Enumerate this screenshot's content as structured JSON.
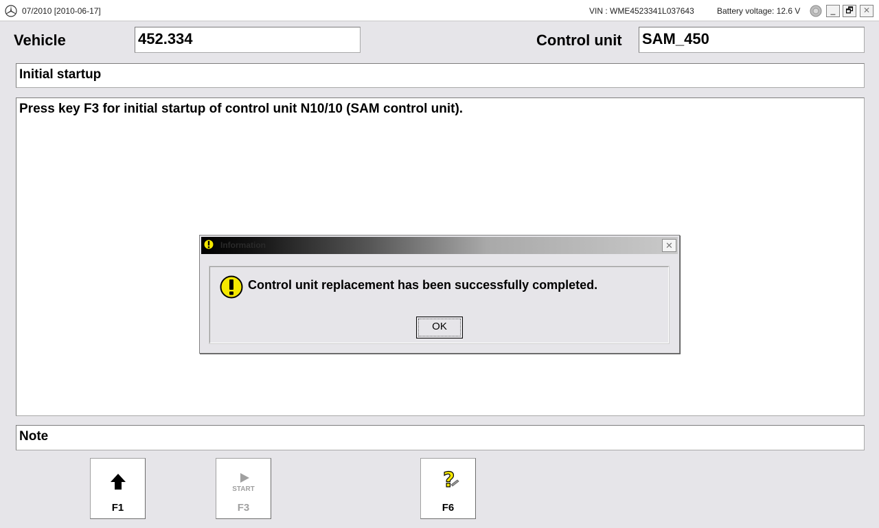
{
  "titlebar": {
    "title": "07/2010 [2010-06-17]",
    "vin": "VIN : WME4523341L037643",
    "battery": "Battery voltage: 12.6 V",
    "icons": [
      "mercedes-star-icon",
      "battery-status-icon"
    ],
    "minimize": "_",
    "maximize": "🗗",
    "close": "✕"
  },
  "header": {
    "vehicle_label": "Vehicle",
    "vehicle_value": "452.334",
    "control_unit_label": "Control unit",
    "control_unit_value": "SAM_450"
  },
  "step": {
    "title": "Initial startup"
  },
  "message": {
    "text": "Press key F3 for initial startup of control unit N10/10 (SAM control unit)."
  },
  "note": {
    "label": "Note"
  },
  "function_keys": [
    {
      "key": "F1",
      "icon": "up-arrow-icon",
      "enabled": true
    },
    {
      "key": "F3",
      "icon": "start-play-icon",
      "sublabel": "START",
      "enabled": false
    },
    {
      "key": "F6",
      "icon": "help-question-icon",
      "enabled": true
    }
  ],
  "dialog": {
    "title": "Information",
    "icon": "warning-exclamation-icon",
    "message": "Control unit replacement has been successfully completed.",
    "ok_label": "OK",
    "close": "✕"
  },
  "colors": {
    "background": "#e6e5e9",
    "field": "#ffffff",
    "warning_yellow": "#f5e800"
  }
}
